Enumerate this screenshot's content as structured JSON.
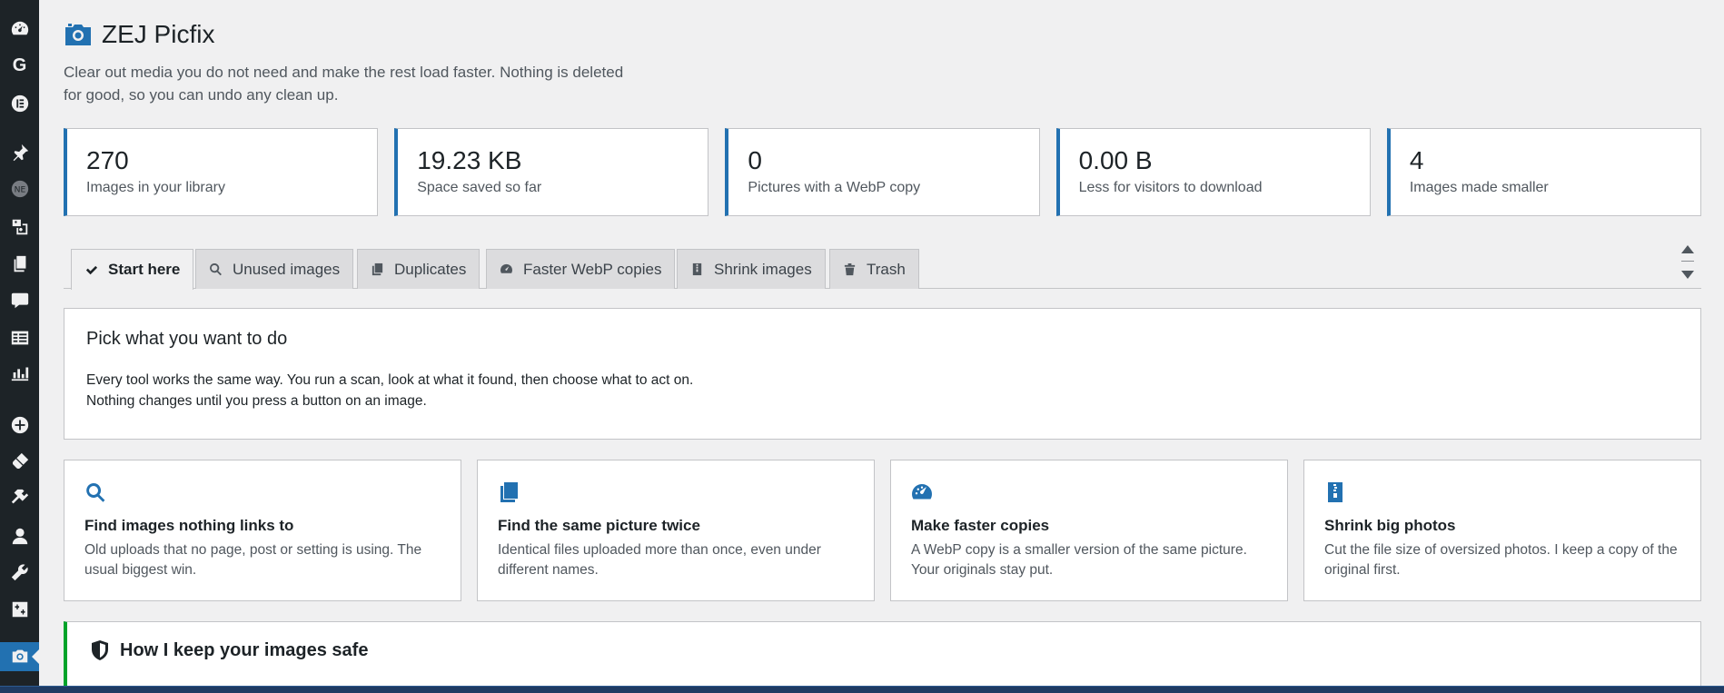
{
  "sidebar": {
    "items": [
      {
        "icon": "dashboard-icon"
      },
      {
        "icon": "google-icon"
      },
      {
        "icon": "elementor-icon"
      },
      {
        "icon": "pin-icon"
      },
      {
        "icon": "ne-icon"
      },
      {
        "icon": "media-icon"
      },
      {
        "icon": "pages-icon"
      },
      {
        "icon": "comments-icon"
      },
      {
        "icon": "forms-icon"
      },
      {
        "icon": "analytics-icon"
      },
      {
        "icon": "add-icon"
      },
      {
        "icon": "appearance-icon"
      },
      {
        "icon": "plugins-icon"
      },
      {
        "icon": "users-icon"
      },
      {
        "icon": "tools-icon"
      },
      {
        "icon": "settings-icon"
      },
      {
        "icon": "camera-icon"
      }
    ]
  },
  "header": {
    "title": "ZEJ Picfix",
    "intro": "Clear out media you do not need and make the rest load faster. Nothing is deleted for good, so you can undo any clean up."
  },
  "stats": [
    {
      "value": "270",
      "label": "Images in your library"
    },
    {
      "value": "19.23 KB",
      "label": "Space saved so far"
    },
    {
      "value": "0",
      "label": "Pictures with a WebP copy"
    },
    {
      "value": "0.00 B",
      "label": "Less for visitors to download"
    },
    {
      "value": "4",
      "label": "Images made smaller"
    }
  ],
  "tabs": [
    {
      "label": "Start here",
      "icon": "check-icon",
      "active": true
    },
    {
      "label": "Unused images",
      "icon": "search-icon"
    },
    {
      "label": "Duplicates",
      "icon": "copy-icon"
    },
    {
      "label": "Faster WebP copies",
      "icon": "speed-icon"
    },
    {
      "label": "Shrink images",
      "icon": "zip-icon"
    },
    {
      "label": "Trash",
      "icon": "trash-icon"
    }
  ],
  "panel": {
    "title": "Pick what you want to do",
    "text": "Every tool works the same way. You run a scan, look at what it found, then choose what to act on. Nothing changes until you press a button on an image."
  },
  "cards": [
    {
      "icon": "search-icon",
      "title": "Find images nothing links to",
      "text": "Old uploads that no page, post or setting is using. The usual biggest win."
    },
    {
      "icon": "copy-icon",
      "title": "Find the same picture twice",
      "text": "Identical files uploaded more than once, even under different names."
    },
    {
      "icon": "speed-icon",
      "title": "Make faster copies",
      "text": "A WebP copy is a smaller version of the same picture. Your originals stay put."
    },
    {
      "icon": "zip-icon",
      "title": "Shrink big photos",
      "text": "Cut the file size of oversized photos. I keep a copy of the original first."
    }
  ],
  "safe": {
    "title": "How I keep your images safe",
    "icon": "shield-icon"
  },
  "colors": {
    "accent": "#2271b1",
    "success": "#00a32a",
    "sidebar": "#1d2327"
  }
}
